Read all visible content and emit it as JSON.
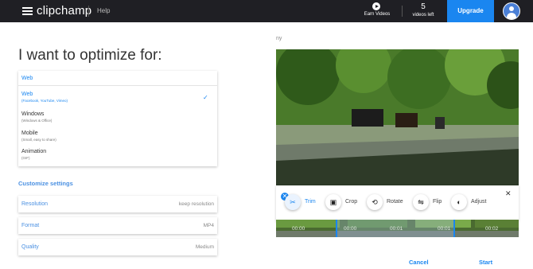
{
  "topbar": {
    "logo": "clipchamp",
    "help": "Help",
    "earn_label": "Earn Videos",
    "videos_left_count": "5",
    "videos_left_label": "videos left",
    "upgrade": "Upgrade"
  },
  "left": {
    "heading": "I want to optimize for:",
    "dropdown_selected": "Web",
    "options": [
      {
        "title": "Web",
        "subtitle": "(Facebook, YouTube, Vimeo)",
        "selected": true
      },
      {
        "title": "Windows",
        "subtitle": "(Windows & Office)",
        "selected": false
      },
      {
        "title": "Mobile",
        "subtitle": "(Small, easy to share)",
        "selected": false
      },
      {
        "title": "Animation",
        "subtitle": "(GIF)",
        "selected": false
      }
    ],
    "customize": "Customize settings",
    "settings": [
      {
        "label": "Resolution",
        "value": "keep resolution"
      },
      {
        "label": "Format",
        "value": "MP4"
      },
      {
        "label": "Quality",
        "value": "Medium"
      }
    ]
  },
  "right": {
    "filename": "ny",
    "tools": [
      {
        "label": "Trim",
        "icon": "scissors-icon"
      },
      {
        "label": "Crop",
        "icon": "crop-icon"
      },
      {
        "label": "Rotate",
        "icon": "rotate-icon"
      },
      {
        "label": "Flip",
        "icon": "flip-icon"
      },
      {
        "label": "Adjust",
        "icon": "adjust-icon"
      }
    ],
    "timecodes": [
      "00:00",
      "00:00",
      "00:01",
      "00:01",
      "00:02"
    ],
    "cancel": "Cancel",
    "start": "Start"
  },
  "colors": {
    "accent": "#1a86f0",
    "topbar": "#1f1f24"
  }
}
